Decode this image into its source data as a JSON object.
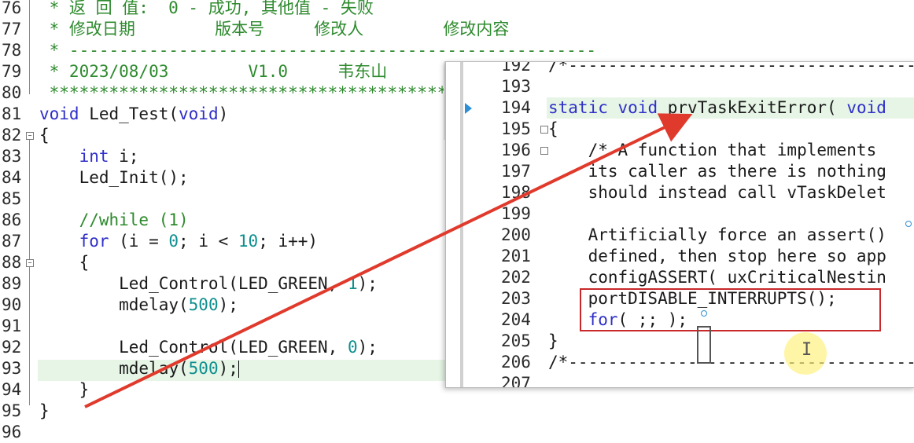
{
  "left_editor": {
    "lines": [
      {
        "num": "76",
        "text": " * 返 回 值:  0 - 成功, 其他值 - 失败"
      },
      {
        "num": "77",
        "text": " * 修改日期        版本号     修改人        修改内容"
      },
      {
        "num": "78",
        "text": " * -----------------------------------------------------"
      },
      {
        "num": "79",
        "text": " * 2023/08/03        V1.0     韦东山"
      },
      {
        "num": "80",
        "text": " ***************************************************"
      },
      {
        "num": "81",
        "text": "void Led_Test(void)"
      },
      {
        "num": "82",
        "text": "{"
      },
      {
        "num": "83",
        "text": "    int i;"
      },
      {
        "num": "84",
        "text": "    Led_Init();"
      },
      {
        "num": "85",
        "text": ""
      },
      {
        "num": "86",
        "text": "    //while (1)"
      },
      {
        "num": "87",
        "text": "    for (i = 0; i < 10; i++)"
      },
      {
        "num": "88",
        "text": "    {"
      },
      {
        "num": "89",
        "text": "        Led_Control(LED_GREEN, 1);"
      },
      {
        "num": "90",
        "text": "        mdelay(500);"
      },
      {
        "num": "91",
        "text": ""
      },
      {
        "num": "92",
        "text": "        Led_Control(LED_GREEN, 0);"
      },
      {
        "num": "93",
        "text": "        mdelay(500);"
      },
      {
        "num": "94",
        "text": "    }"
      },
      {
        "num": "95",
        "text": "}"
      },
      {
        "num": "96",
        "text": ""
      }
    ]
  },
  "popup": {
    "lines": [
      {
        "num": "192",
        "text": "/*-----------------------------------------"
      },
      {
        "num": "193",
        "text": ""
      },
      {
        "num": "194",
        "text": "static void prvTaskExitError( void"
      },
      {
        "num": "195",
        "text": "{"
      },
      {
        "num": "196",
        "text": "    /* A function that implements"
      },
      {
        "num": "197",
        "text": "    its caller as there is nothing"
      },
      {
        "num": "198",
        "text": "    should instead call vTaskDelet"
      },
      {
        "num": "199",
        "text": ""
      },
      {
        "num": "200",
        "text": "    Artificially force an assert()"
      },
      {
        "num": "201",
        "text": "    defined, then stop here so app"
      },
      {
        "num": "202",
        "text": "    configASSERT( uxCriticalNestin"
      },
      {
        "num": "203",
        "text": "    portDISABLE_INTERRUPTS();"
      },
      {
        "num": "204",
        "text": "    for( ;; );"
      },
      {
        "num": "205",
        "text": "}"
      },
      {
        "num": "206",
        "text": "/*-----------------------------------------"
      },
      {
        "num": "207",
        "text": ""
      }
    ]
  },
  "cursor_glyph": "I",
  "colors": {
    "keyword": "#2f2fc8",
    "comment": "#2d8a2d",
    "number": "#0f8f8f",
    "highlight": "#e6f5e6",
    "annotation_red": "#c8282a",
    "marker_blue": "#2c8fd6"
  }
}
